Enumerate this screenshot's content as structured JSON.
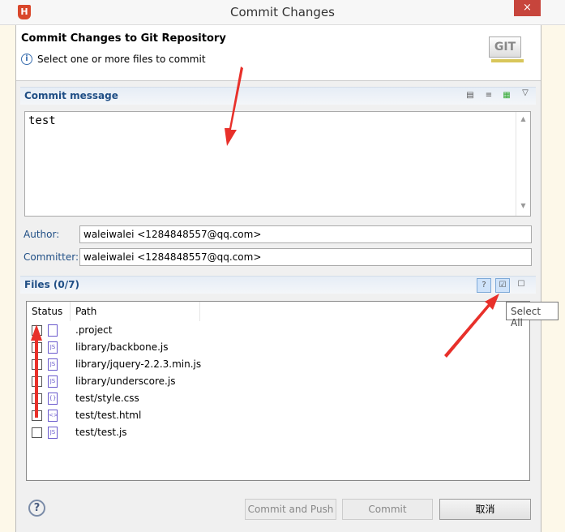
{
  "window": {
    "title": "Commit Changes",
    "close": "×",
    "app_icon": "H"
  },
  "header": {
    "title": "Commit Changes to Git Repository",
    "subtitle": "Select one or more files to commit",
    "logo": "GIT"
  },
  "commit_message": {
    "label": "Commit message",
    "value": "test"
  },
  "author": {
    "label": "Author:",
    "value": "waleiwalei <1284848557@qq.com>"
  },
  "committer": {
    "label": "Committer:",
    "value": "waleiwalei <1284848557@qq.com>"
  },
  "files": {
    "label": "Files (0/7)",
    "columns": [
      "Status",
      "Path"
    ],
    "rows": [
      {
        "path": ".project",
        "icon": "xml-file-icon",
        "checked": false
      },
      {
        "path": "library/backbone.js",
        "icon": "js-file-icon",
        "checked": false
      },
      {
        "path": "library/jquery-2.2.3.min.js",
        "icon": "js-file-icon",
        "checked": false
      },
      {
        "path": "library/underscore.js",
        "icon": "js-file-icon",
        "checked": false
      },
      {
        "path": "test/style.css",
        "icon": "css-file-icon",
        "checked": false
      },
      {
        "path": "test/test.html",
        "icon": "html-file-icon",
        "checked": false
      },
      {
        "path": "test/test.js",
        "icon": "js-file-icon",
        "checked": false
      }
    ]
  },
  "tooltip": "Select All",
  "buttons": {
    "commit_push": "Commit and Push",
    "commit": "Commit",
    "cancel": "取消"
  },
  "colors": {
    "accent": "#1f4e85",
    "close": "#c7453c",
    "arrow": "#e8302a"
  }
}
